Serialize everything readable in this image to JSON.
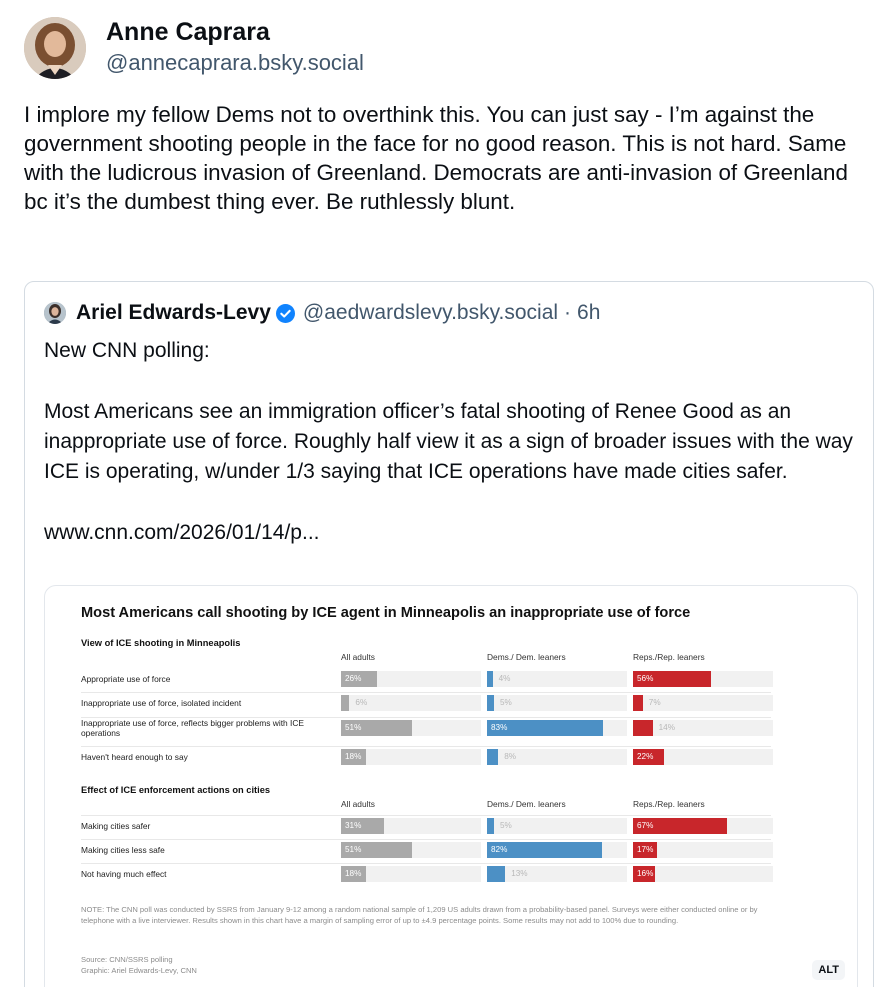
{
  "author": {
    "display_name": "Anne Caprara",
    "handle": "@annecaprara.bsky.social"
  },
  "post_text": "I implore my fellow Dems not to overthink this. You can just say - I’m against the government shooting people in the face for no good reason. This is not hard. Same with the ludicrous invasion of Greenland. Democrats are anti-invasion of Greenland bc it’s the dumbest thing ever. Be ruthlessly blunt.",
  "quote": {
    "display_name": "Ariel Edwards-Levy",
    "handle": "@aedwardslevy.bsky.social",
    "separator": "·",
    "time": "6h",
    "text": "New CNN polling:\n\nMost Americans see an immigration officer’s fatal shooting of Renee Good as an inappropriate use of force. Roughly half view it as a sign of broader issues with the way ICE is operating, w/under 1/3 saying that ICE operations have made cities safer.\n\nwww.cnn.com/2026/01/14/p...",
    "alt_badge": "ALT"
  },
  "colors": {
    "all_adults": "#a9a9a9",
    "dems": "#4c90c5",
    "reps": "#c8262b",
    "verified": "#1083fe"
  },
  "icons": [
    "verified-badge-icon"
  ],
  "chart_data": {
    "type": "bar",
    "title": "Most Americans call shooting by ICE agent in Minneapolis an inappropriate use of force",
    "columns": [
      "All adults",
      "Dems./ Dem. leaners",
      "Reps./Rep. leaners"
    ],
    "xlim": [
      0,
      100
    ],
    "sections": [
      {
        "title": "View of ICE shooting in Minneapolis",
        "categories": [
          "Appropriate use of force",
          "Inappropriate use of force, isolated incident",
          "Inappropriate use of force, reflects bigger problems with ICE operations",
          "Haven't heard enough to say"
        ],
        "series": [
          {
            "name": "All adults",
            "values": [
              26,
              6,
              51,
              18
            ]
          },
          {
            "name": "Dems./ Dem. leaners",
            "values": [
              4,
              5,
              83,
              8
            ]
          },
          {
            "name": "Reps./Rep. leaners",
            "values": [
              56,
              7,
              14,
              22
            ]
          }
        ]
      },
      {
        "title": "Effect of ICE enforcement actions on cities",
        "categories": [
          "Making cities safer",
          "Making cities less safe",
          "Not having much effect"
        ],
        "series": [
          {
            "name": "All adults",
            "values": [
              31,
              51,
              18
            ]
          },
          {
            "name": "Dems./ Dem. leaners",
            "values": [
              5,
              82,
              13
            ]
          },
          {
            "name": "Reps./Rep. leaners",
            "values": [
              67,
              17,
              16
            ]
          }
        ]
      }
    ],
    "note": "NOTE: The CNN poll was conducted by SSRS from January 9-12 among a random national sample of 1,209 US adults drawn from a probability-based panel. Surveys were either conducted online or by telephone with a live interviewer. Results shown in this chart have a margin of sampling error of up to ±4.9 percentage points. Some results may not add to 100% due to rounding.",
    "source": "Source: CNN/SSRS polling",
    "graphic_credit": "Graphic: Ariel Edwards-Levy, CNN"
  }
}
